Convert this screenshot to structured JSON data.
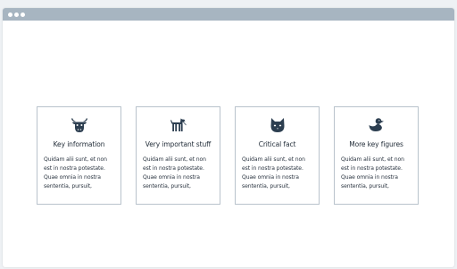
{
  "window": {
    "titlebar_color": "#a7b5c1"
  },
  "cards": [
    {
      "icon": "cow-icon",
      "title": "Key information",
      "body": "Quidam alii sunt, et non est in nostra potestate. Quae omnia in nostra sententia, pursuit,"
    },
    {
      "icon": "dog-icon",
      "title": "Very important stuff",
      "body": "Quidam alii sunt, et non est in nostra potestate. Quae omnia in nostra sententia, pursuit,"
    },
    {
      "icon": "cat-icon",
      "title": "Critical fact",
      "body": "Quidam alii sunt, et non est in nostra potestate. Quae omnia in nostra sententia, pursuit,"
    },
    {
      "icon": "duck-icon",
      "title": "More key figures",
      "body": "Quidam alii sunt, et non est in nostra potestate. Quae omnia in nostra sententia, pursuit,"
    }
  ],
  "colors": {
    "icon": "#2c3e50",
    "card_border": "#b9c3cc",
    "text": "#1f2a36"
  }
}
